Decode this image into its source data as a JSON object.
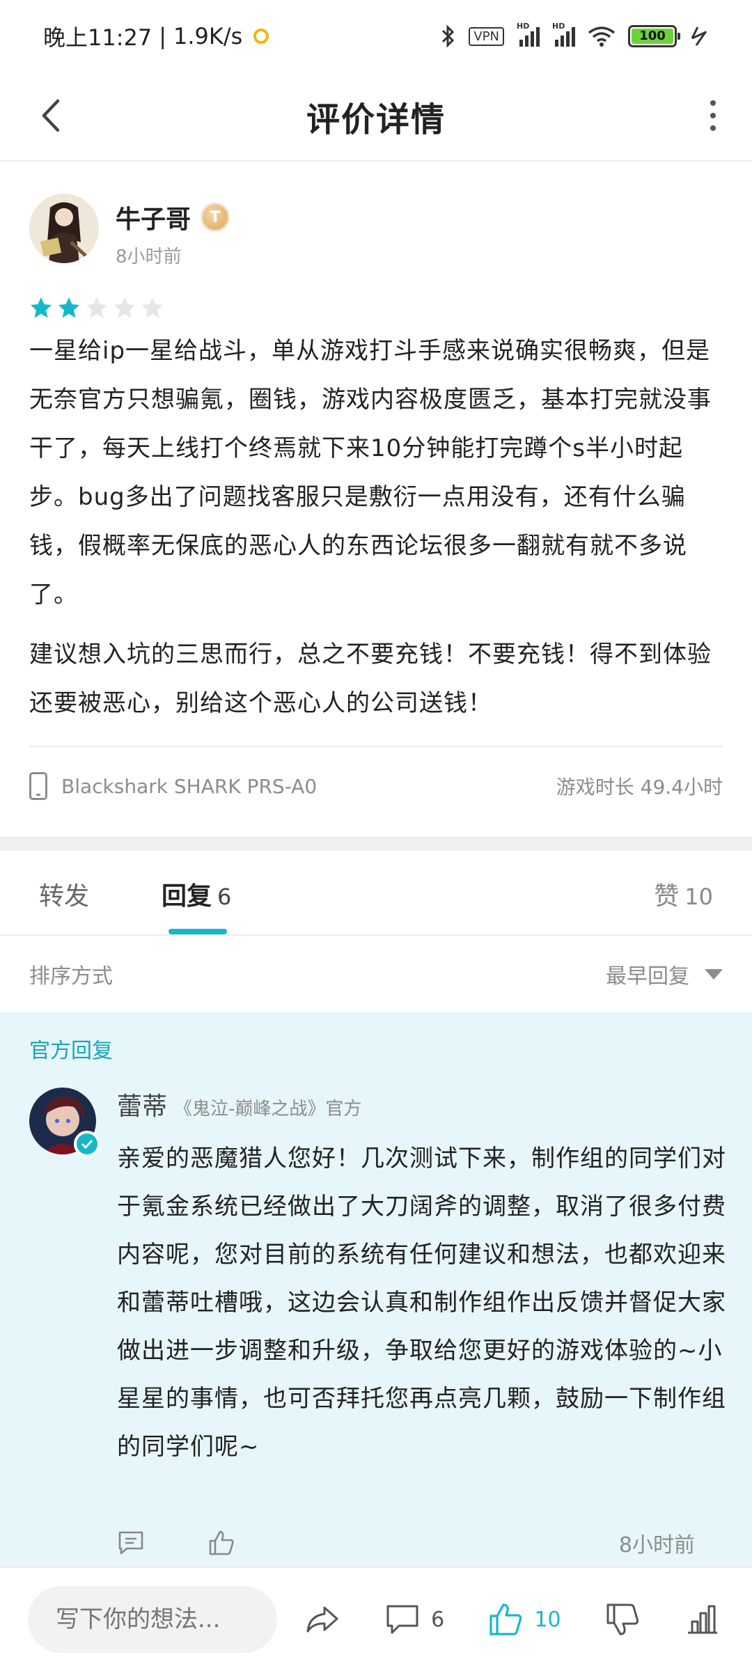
{
  "status_bar": {
    "time": "晚上11:27",
    "network_speed": "1.9K/s",
    "vpn": "VPN",
    "hd": "HD",
    "battery": "100"
  },
  "header": {
    "title": "评价详情"
  },
  "review": {
    "author_name": "牛子哥",
    "author_level": "T",
    "time": "8小时前",
    "rating": 2,
    "rating_max": 5,
    "paragraphs": [
      "一星给ip一星给战斗，单从游戏打斗手感来说确实很畅爽，但是无奈官方只想骗氪，圈钱，游戏内容极度匮乏，基本打完就没事干了，每天上线打个终焉就下来10分钟能打完蹲个s半小时起步。bug多出了问题找客服只是敷衍一点用没有，还有什么骗钱，假概率无保底的恶心人的东西论坛很多一翻就有就不多说了。",
      "建议想入坑的三思而行，总之不要充钱！不要充钱！得不到体验还要被恶心，别给这个恶心人的公司送钱！"
    ],
    "device": "Blackshark SHARK PRS-A0",
    "playtime": "游戏时长 49.4小时"
  },
  "tabs": {
    "forward": "转发",
    "reply": "回复",
    "reply_count": "6",
    "like": "赞",
    "like_count": "10"
  },
  "sort": {
    "label": "排序方式",
    "value": "最早回复"
  },
  "official_reply": {
    "section_label": "官方回复",
    "name": "蕾蒂",
    "role": "《鬼泣-巅峰之战》官方",
    "text": "亲爱的恶魔猎人您好！几次测试下来，制作组的同学们对于氪金系统已经做出了大刀阔斧的调整，取消了很多付费内容呢，您对目前的系统有任何建议和想法，也都欢迎来和蕾蒂吐槽哦，这边会认真和制作组作出反馈并督促大家做出进一步调整和升级，争取给您更好的游戏体验的~小星星的事情，也可否拜托您再点亮几颗，鼓励一下制作组的同学们呢~",
    "time": "8小时前"
  },
  "bottom_bar": {
    "input_placeholder": "写下你的想法...",
    "comment_count": "6",
    "like_count": "10"
  },
  "colors": {
    "accent": "#15b8c7",
    "official_bg": "#e6f6fa"
  }
}
